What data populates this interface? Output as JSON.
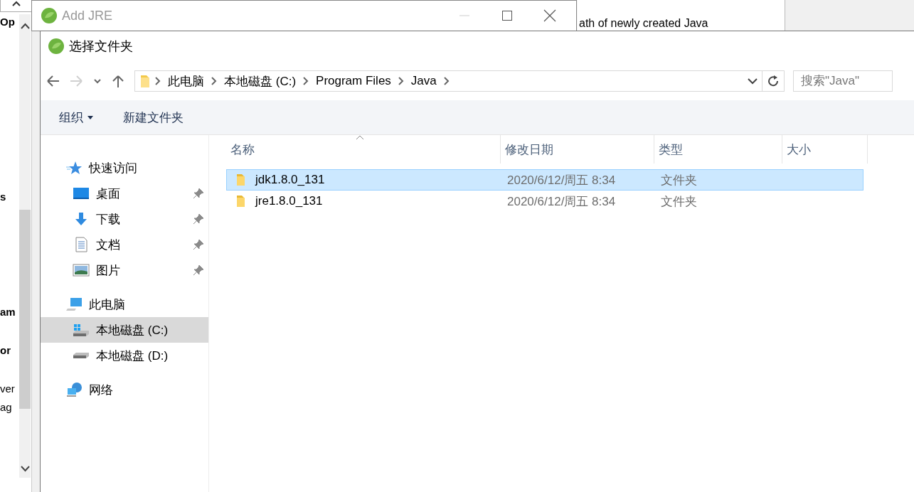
{
  "background_window": {
    "fragments": [
      "Op",
      "s",
      "am",
      "or",
      "ver",
      "ag"
    ],
    "description": "ath of newly created Java"
  },
  "add_jre_window": {
    "title": "Add JRE"
  },
  "folder_dialog": {
    "title": "选择文件夹",
    "nav_buttons": [
      {
        "kind": "back",
        "disabled": false
      },
      {
        "kind": "forward",
        "disabled": true
      },
      {
        "kind": "recent",
        "disabled": false
      },
      {
        "kind": "up",
        "disabled": false
      }
    ],
    "breadcrumb": [
      "此电脑",
      "本地磁盘 (C:)",
      "Program Files",
      "Java"
    ],
    "search": {
      "placeholder": "搜索\"Java\""
    },
    "toolbar": [
      {
        "label": "组织",
        "dropdown": true
      },
      {
        "label": "新建文件夹",
        "dropdown": false
      }
    ],
    "nav_pane": [
      {
        "label": "快速访问",
        "kind": "star",
        "selected": false,
        "children": [
          {
            "label": "桌面",
            "kind": "desktop",
            "pinned": true,
            "selected": false
          },
          {
            "label": "下载",
            "kind": "download",
            "pinned": true,
            "selected": false
          },
          {
            "label": "文档",
            "kind": "document",
            "pinned": true,
            "selected": false
          },
          {
            "label": "图片",
            "kind": "pictures",
            "pinned": true,
            "selected": false
          }
        ]
      },
      {
        "label": "此电脑",
        "kind": "computer",
        "selected": false,
        "children": [
          {
            "label": "本地磁盘 (C:)",
            "kind": "system-drive",
            "pinned": false,
            "selected": true
          },
          {
            "label": "本地磁盘 (D:)",
            "kind": "drive",
            "pinned": false,
            "selected": false
          }
        ]
      },
      {
        "label": "网络",
        "kind": "network",
        "selected": false
      }
    ],
    "columns": [
      "名称",
      "修改日期",
      "类型",
      "大小"
    ],
    "rows": [
      {
        "name": "jdk1.8.0_131",
        "modified": "2020/6/12/周五 8:34",
        "type": "文件夹",
        "selected": true
      },
      {
        "name": "jre1.8.0_131",
        "modified": "2020/6/12/周五 8:34",
        "type": "文件夹",
        "selected": false
      }
    ]
  }
}
